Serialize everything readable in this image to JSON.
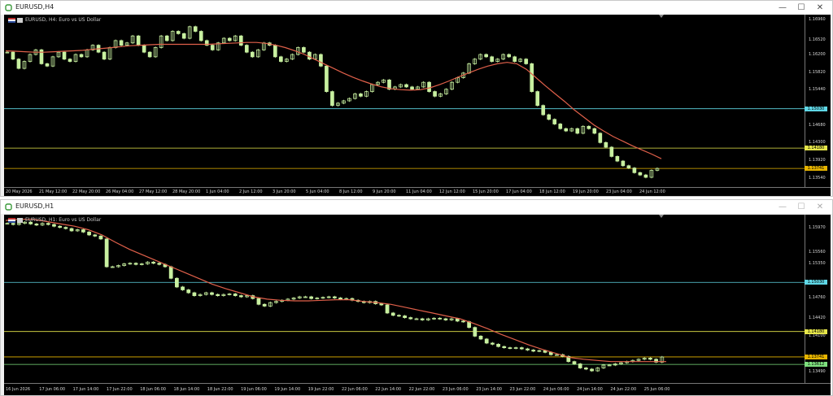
{
  "windows": [
    {
      "id": "h4",
      "title": "EURUSD,H4",
      "info_text": "EURUSD, H4:  Euro vs US Dollar",
      "dim": false,
      "prices": [
        "1.16960",
        "1.16520",
        "1.16200",
        "1.15820",
        "1.15440",
        "1.14680",
        "1.14300",
        "1.13920",
        "1.13540"
      ],
      "times": [
        "20 May 2026",
        "21 May 12:00",
        "22 May 20:00",
        "26 May 04:00",
        "27 May 12:00",
        "28 May 20:00",
        "1 Jun 04:00",
        "2 Jun 12:00",
        "3 Jun 20:00",
        "5 Jun 04:00",
        "8 Jun 12:00",
        "9 Jun 20:00",
        "11 Jun 04:00",
        "12 Jun 12:00",
        "15 Jun 20:00",
        "17 Jun 04:00",
        "18 Jun 12:00",
        "19 Jun 20:00",
        "23 Jun 04:00",
        "24 Jun 12:00"
      ],
      "tags": [
        {
          "text": "1.15030",
          "color": "#5fd7e6"
        },
        {
          "text": "1.14180",
          "color": "#e6e64a"
        },
        {
          "text": "1.13741",
          "color": "#e6b400"
        }
      ]
    },
    {
      "id": "h1",
      "title": "EURUSD,H1",
      "info_text": "EURUSD, H1:  Euro vs US Dollar",
      "dim": true,
      "prices": [
        "1.15970",
        "1.15560",
        "1.15350",
        "1.14760",
        "1.14420",
        "1.14100",
        "1.13490"
      ],
      "times": [
        "16 Jun 2026",
        "17 Jun 06:00",
        "17 Jun 14:00",
        "17 Jun 22:00",
        "18 Jun 06:00",
        "18 Jun 14:00",
        "18 Jun 22:00",
        "19 Jun 06:00",
        "19 Jun 14:00",
        "19 Jun 22:00",
        "22 Jun 06:00",
        "22 Jun 14:00",
        "22 Jun 22:00",
        "23 Jun 06:00",
        "23 Jun 14:00",
        "23 Jun 22:00",
        "24 Jun 06:00",
        "24 Jun 14:00",
        "24 Jun 22:00",
        "25 Jun 06:00"
      ],
      "tags": [
        {
          "text": "1.15030",
          "color": "#5fd7e6"
        },
        {
          "text": "1.14180",
          "color": "#e6e64a"
        },
        {
          "text": "1.13741",
          "color": "#e6b400"
        },
        {
          "text": "1.13612",
          "color": "#7ee07e"
        }
      ]
    }
  ],
  "window_buttons": {
    "minimize": "—",
    "maximize": "☐",
    "close": "✕"
  },
  "colors": {
    "background": "#000000",
    "candle": "#c8f0a0",
    "ma": "#e0604a",
    "cyan": "#5fd7e6",
    "yellow": "#e6e64a",
    "orange": "#e6b400",
    "green": "#7ee07e"
  },
  "chart_data": [
    {
      "type": "candlestick",
      "timeframe": "H4",
      "symbol": "EURUSD",
      "ylim": [
        1.1334,
        1.1706
      ],
      "close": [
        1.1625,
        1.161,
        1.159,
        1.1605,
        1.162,
        1.163,
        1.16,
        1.1595,
        1.1615,
        1.1625,
        1.161,
        1.1605,
        1.162,
        1.1615,
        1.163,
        1.164,
        1.1625,
        1.161,
        1.1635,
        1.165,
        1.164,
        1.1645,
        1.166,
        1.164,
        1.1625,
        1.1615,
        1.1635,
        1.166,
        1.165,
        1.167,
        1.1665,
        1.1655,
        1.168,
        1.167,
        1.165,
        1.164,
        1.163,
        1.1645,
        1.1655,
        1.165,
        1.166,
        1.164,
        1.1625,
        1.1615,
        1.163,
        1.1645,
        1.164,
        1.1615,
        1.1605,
        1.161,
        1.162,
        1.1635,
        1.1625,
        1.161,
        1.162,
        1.1595,
        1.154,
        1.151,
        1.1515,
        1.152,
        1.1525,
        1.1535,
        1.153,
        1.154,
        1.1555,
        1.156,
        1.1565,
        1.1545,
        1.155,
        1.1555,
        1.155,
        1.1545,
        1.155,
        1.156,
        1.154,
        1.153,
        1.1535,
        1.1545,
        1.156,
        1.157,
        1.158,
        1.16,
        1.161,
        1.162,
        1.1615,
        1.1605,
        1.161,
        1.162,
        1.1615,
        1.1605,
        1.161,
        1.16,
        1.154,
        1.151,
        1.149,
        1.148,
        1.147,
        1.146,
        1.1455,
        1.146,
        1.145,
        1.1465,
        1.146,
        1.145,
        1.143,
        1.142,
        1.14,
        1.139,
        1.138,
        1.1375,
        1.1365,
        1.136,
        1.1355,
        1.137,
        1.1374
      ],
      "ma": [
        1.1628,
        1.1627,
        1.1626,
        1.1625,
        1.1625,
        1.1626,
        1.1627,
        1.1628,
        1.1629,
        1.1631,
        1.1633,
        1.1635,
        1.1637,
        1.1639,
        1.164,
        1.1641,
        1.1642,
        1.1642,
        1.1642,
        1.1642,
        1.1642,
        1.1642,
        1.1643,
        1.1644,
        1.1645,
        1.1646,
        1.1646,
        1.1644,
        1.164,
        1.1635,
        1.1628,
        1.162,
        1.161,
        1.16,
        1.159,
        1.158,
        1.1571,
        1.1563,
        1.1556,
        1.155,
        1.1546,
        1.1544,
        1.1543,
        1.1544,
        1.1548,
        1.1555,
        1.1563,
        1.1572,
        1.158,
        1.1588,
        1.1595,
        1.16,
        1.1603,
        1.16,
        1.1588,
        1.157,
        1.1552,
        1.1535,
        1.1518,
        1.15,
        1.1484,
        1.1468,
        1.1455,
        1.1443,
        1.1433,
        1.1423,
        1.1414,
        1.1405,
        1.1395
      ],
      "hlines": [
        1.1503,
        1.1418,
        1.13741
      ],
      "title": "EURUSD, H4:  Euro vs US Dollar"
    },
    {
      "type": "candlestick",
      "timeframe": "H1",
      "symbol": "EURUSD",
      "ylim": [
        1.1329,
        1.162
      ],
      "close": [
        1.1605,
        1.1603,
        1.1605,
        1.1607,
        1.1604,
        1.1602,
        1.1605,
        1.1603,
        1.16,
        1.1598,
        1.1596,
        1.1592,
        1.1594,
        1.159,
        1.1585,
        1.1583,
        1.1578,
        1.153,
        1.153,
        1.1532,
        1.1535,
        1.1536,
        1.1534,
        1.1535,
        1.1538,
        1.1536,
        1.1534,
        1.153,
        1.151,
        1.1495,
        1.149,
        1.1485,
        1.148,
        1.1482,
        1.1485,
        1.1482,
        1.148,
        1.1482,
        1.1483,
        1.148,
        1.1478,
        1.148,
        1.1475,
        1.1465,
        1.1462,
        1.1468,
        1.147,
        1.1472,
        1.1474,
        1.1476,
        1.1478,
        1.1478,
        1.1475,
        1.1476,
        1.1477,
        1.1478,
        1.1476,
        1.1474,
        1.1475,
        1.1472,
        1.147,
        1.1468,
        1.147,
        1.1466,
        1.1464,
        1.145,
        1.1446,
        1.1445,
        1.1442,
        1.144,
        1.144,
        1.1438,
        1.144,
        1.1441,
        1.144,
        1.1438,
        1.144,
        1.1436,
        1.1435,
        1.1425,
        1.141,
        1.1405,
        1.1398,
        1.1396,
        1.1392,
        1.139,
        1.1389,
        1.139,
        1.1388,
        1.1386,
        1.1384,
        1.1385,
        1.1382,
        1.1378,
        1.1378,
        1.1375,
        1.1366,
        1.1362,
        1.1355,
        1.1353,
        1.135,
        1.1355,
        1.136,
        1.136,
        1.1362,
        1.1364,
        1.1366,
        1.1368,
        1.137,
        1.1372,
        1.137,
        1.1365,
        1.1374
      ],
      "ma": [
        1.161,
        1.1612,
        1.1612,
        1.1608,
        1.1604,
        1.16,
        1.1594,
        1.1585,
        1.1572,
        1.156,
        1.155,
        1.154,
        1.153,
        1.152,
        1.151,
        1.15,
        1.1492,
        1.1485,
        1.1478,
        1.1474,
        1.1472,
        1.1471,
        1.1471,
        1.1472,
        1.1473,
        1.1473,
        1.147,
        1.1468,
        1.1465,
        1.146,
        1.1455,
        1.145,
        1.1445,
        1.144,
        1.1432,
        1.1423,
        1.1413,
        1.1404,
        1.1395,
        1.1387,
        1.138,
        1.1373,
        1.137,
        1.1368,
        1.1366,
        1.1366,
        1.1366,
        1.1366,
        1.1366
      ],
      "hlines": [
        1.1503,
        1.1418,
        1.13741,
        1.13612
      ],
      "title": "EURUSD, H1:  Euro vs US Dollar"
    }
  ]
}
